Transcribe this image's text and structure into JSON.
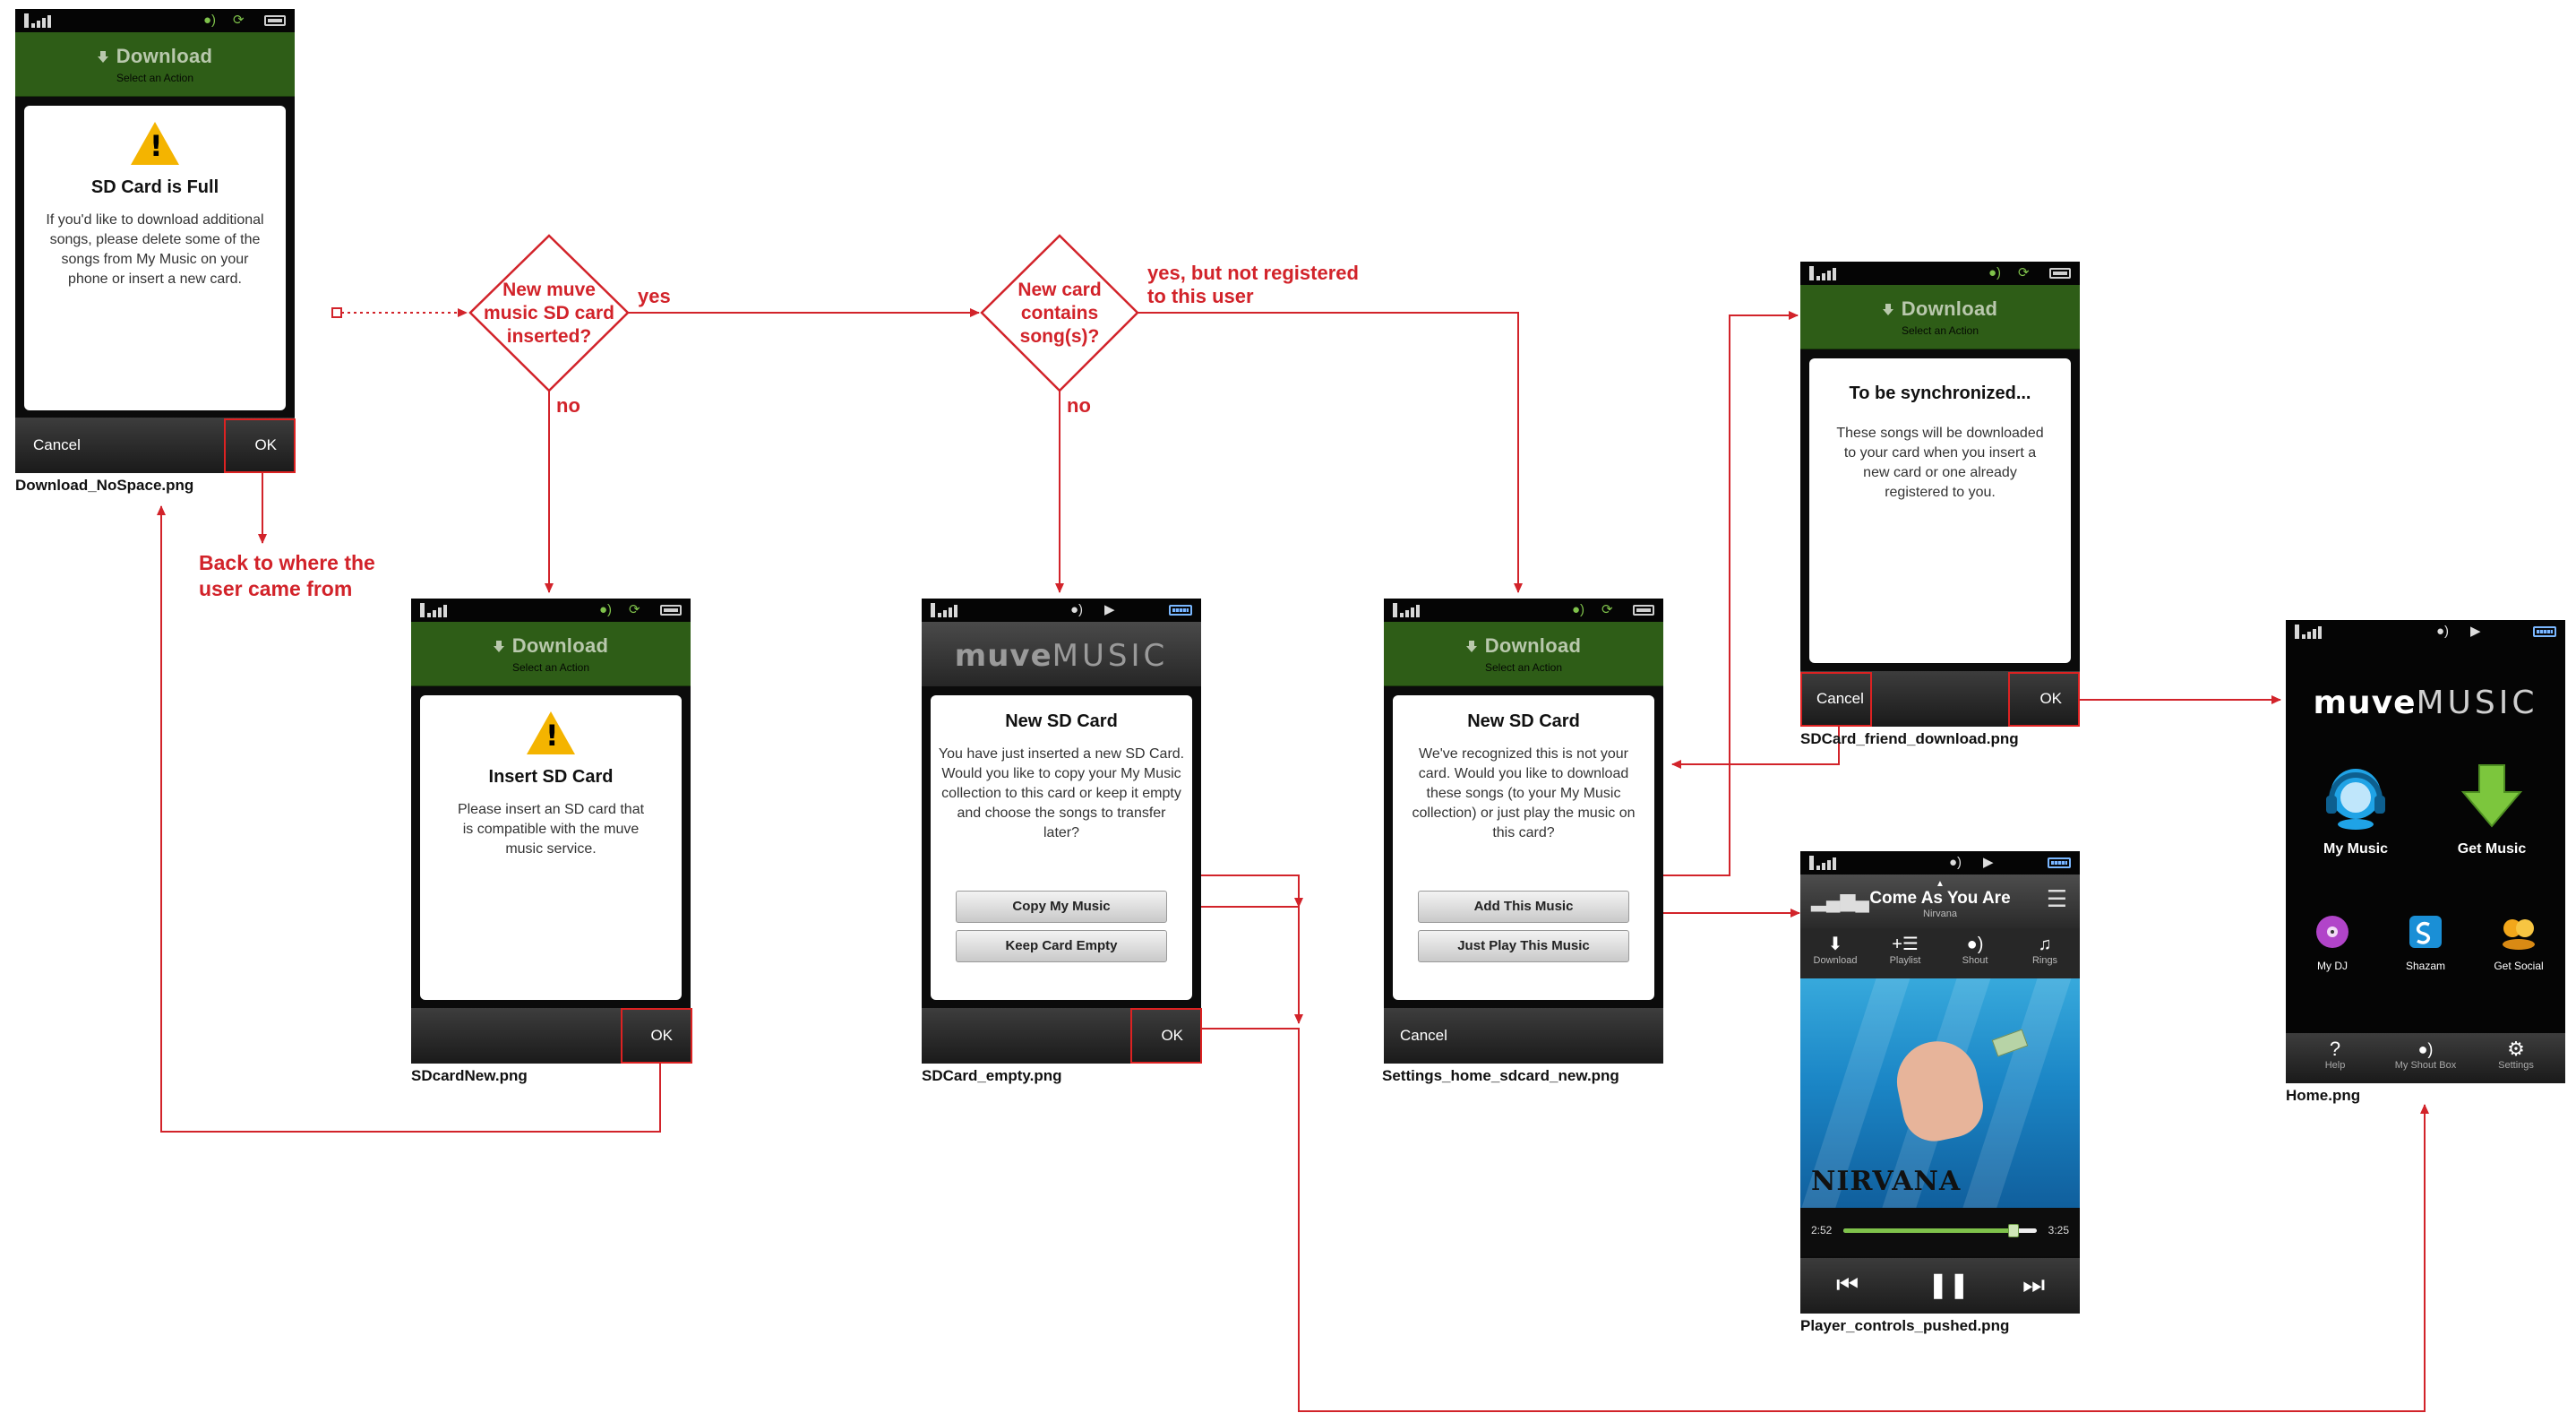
{
  "status_icons": {
    "signal": "signal-bars-icon",
    "sync": "sync-icon",
    "battery": "battery-icon",
    "shout": "shout-icon",
    "play": "play-icon"
  },
  "header": {
    "title": "Download",
    "subtitle": "Select an Action",
    "logo_bold": "muve",
    "logo_light": "MUSIC"
  },
  "screens": {
    "no_space": {
      "title": "SD Card is Full",
      "body": "If you'd like to download additional songs, please delete some of the songs from My Music on your phone or insert a new card.",
      "cancel": "Cancel",
      "ok": "OK",
      "filename": "Download_NoSpace.png"
    },
    "sdcard_new": {
      "title": "Insert SD Card",
      "body": "Please insert an SD card that is compatible with the muve music service.",
      "ok": "OK",
      "filename": "SDcardNew.png"
    },
    "sdcard_empty": {
      "title": "New SD Card",
      "body": "You have just inserted a new SD Card. Would you like to copy your My Music collection to this card or keep it empty and choose the songs to transfer later?",
      "btn_copy": "Copy My Music",
      "btn_keep": "Keep Card Empty",
      "ok": "OK",
      "filename": "SDCard_empty.png"
    },
    "settings_home": {
      "title": "New SD Card",
      "body": "We've recognized this is not your card. Would you like to download these songs (to your My Music collection) or just play the music on this card?",
      "btn_add": "Add This Music",
      "btn_play": "Just Play This Music",
      "cancel": "Cancel",
      "filename": "Settings_home_sdcard_new.png"
    },
    "friend_download": {
      "title": "To be synchronized...",
      "body": "These songs will be downloaded to your card when you insert a new card or one already registered to you.",
      "cancel": "Cancel",
      "ok": "OK",
      "filename": "SDCard_friend_download.png"
    },
    "player": {
      "song": "Come As You Are",
      "artist": "Nirvana",
      "tools": [
        {
          "icon": "download-icon",
          "label": "Download"
        },
        {
          "icon": "add-to-playlist-icon",
          "label": "Playlist"
        },
        {
          "icon": "shout-icon",
          "label": "Shout"
        },
        {
          "icon": "ringtone-icon",
          "label": "Rings"
        }
      ],
      "album_text": "NIRVANA",
      "time_elapsed": "2:52",
      "time_total": "3:25",
      "progress": 0.88,
      "filename": "Player_controls_pushed.png"
    },
    "home": {
      "tiles": [
        {
          "icon": "headphones-icon",
          "label": "My Music"
        },
        {
          "icon": "download-arrow-icon",
          "label": "Get Music"
        }
      ],
      "small_tiles": [
        {
          "icon": "disc-icon",
          "label": "My DJ"
        },
        {
          "icon": "shazam-icon",
          "label": "Shazam"
        },
        {
          "icon": "social-icon",
          "label": "Get Social"
        }
      ],
      "nav": [
        {
          "icon": "help-icon",
          "label": "Help"
        },
        {
          "icon": "shout-icon",
          "label": "My Shout Box"
        },
        {
          "icon": "gear-icon",
          "label": "Settings"
        }
      ],
      "filename": "Home.png"
    }
  },
  "decisions": {
    "d1": "New muve music SD card inserted?",
    "d2": "New card contains song(s)?"
  },
  "labels": {
    "yes": "yes",
    "no": "no",
    "yes_not_registered": "yes, but not registered to this user",
    "back": "Back to where the user came from"
  },
  "colors": {
    "flow_red": "#d2232a",
    "header_green": "#2e5d17",
    "accent_green": "#7fc24b"
  }
}
